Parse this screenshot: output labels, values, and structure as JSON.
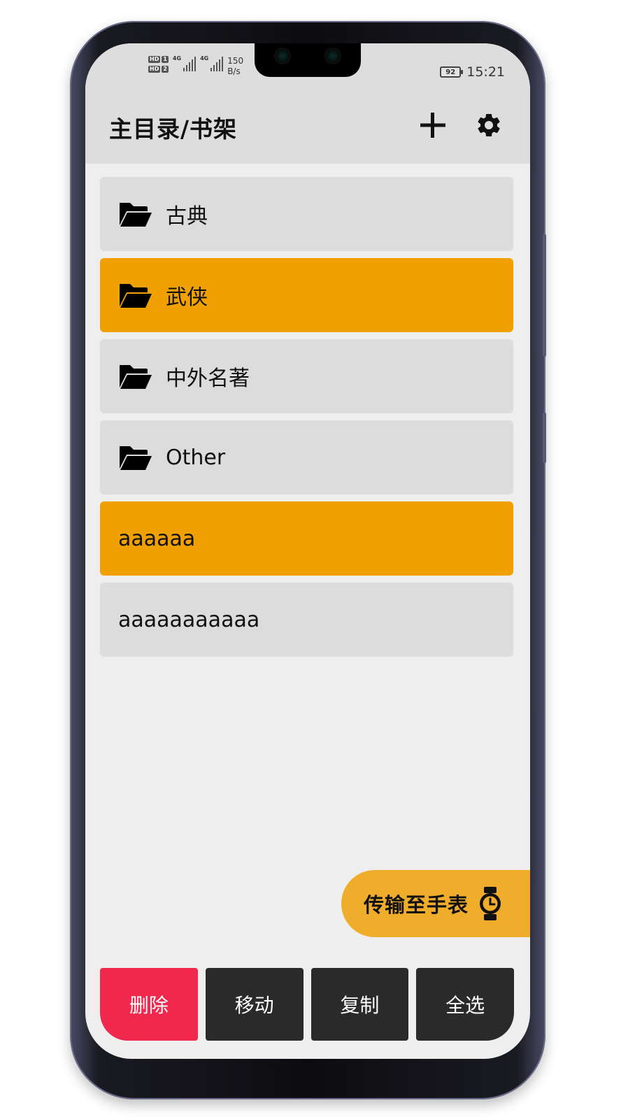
{
  "status_bar": {
    "sim1_badge": "HD",
    "sim1_index": "1",
    "sim2_badge": "HD",
    "sim2_index": "2",
    "net1": "4G",
    "net2": "4G",
    "net_speed_value": "150",
    "net_speed_unit": "B/s",
    "battery": "92",
    "time": "15:21"
  },
  "header": {
    "title": "主目录/书架",
    "add_icon": "plus-icon",
    "settings_icon": "gear-icon"
  },
  "items": [
    {
      "label": "古典",
      "type": "folder",
      "selected": false
    },
    {
      "label": "武侠",
      "type": "folder",
      "selected": true
    },
    {
      "label": "中外名著",
      "type": "folder",
      "selected": false
    },
    {
      "label": "Other",
      "type": "folder",
      "selected": false
    },
    {
      "label": "aaaaaa",
      "type": "file",
      "selected": true
    },
    {
      "label": "aaaaaaaaaaa",
      "type": "file",
      "selected": false
    }
  ],
  "fab": {
    "label": "传输至手表",
    "icon": "watch-icon"
  },
  "actions": {
    "delete": "删除",
    "move": "移动",
    "copy": "复制",
    "select_all": "全选"
  },
  "colors": {
    "selected": "#f0a100",
    "item_bg": "#dcdcdc",
    "fab_bg": "#f0ad2c",
    "danger": "#f0284e",
    "action_bg": "#2a2a2a"
  }
}
